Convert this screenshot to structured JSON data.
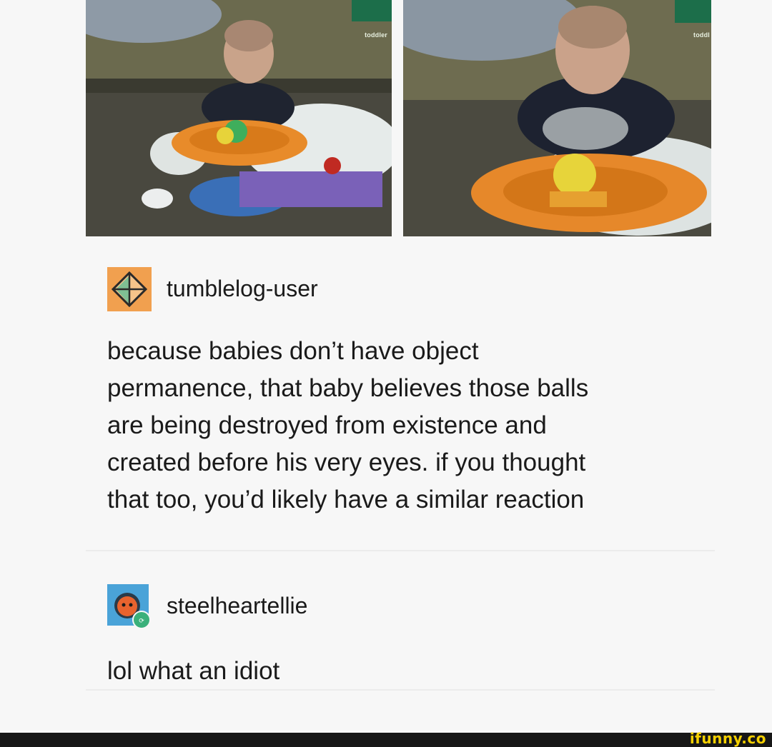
{
  "photos": {
    "left_tag": "toddler",
    "right_tag": "toddl"
  },
  "posts": [
    {
      "username": "tumblelog-user",
      "avatar_icon": "diamond-pyramid-avatar-icon",
      "body_lines": [
        "because babies don’t have object",
        "permanence, that baby believes those balls",
        "are being destroyed from existence and",
        "created before his very eyes. if you thought",
        "that too, you’d likely have a similar reaction"
      ]
    },
    {
      "username": "steelheartellie",
      "avatar_icon": "character-face-avatar-icon",
      "body": "lol what an idiot"
    }
  ],
  "watermark": "ifunny.co",
  "colors": {
    "avatar1_bg": "#f1a04f",
    "avatar2_bg": "#4aa3d8",
    "watermark": "#f5d000",
    "footer": "#171717"
  }
}
